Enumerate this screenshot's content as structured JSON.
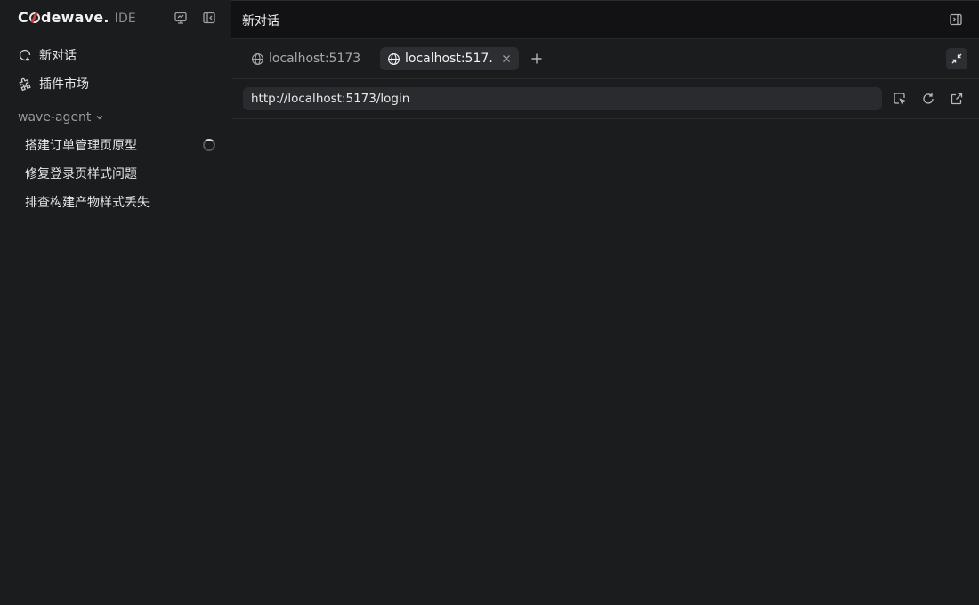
{
  "brand": {
    "first_letter": "C",
    "rest": "dewave",
    "dot": ".",
    "suffix": "IDE"
  },
  "sidebar": {
    "nav": [
      {
        "label": "新对话",
        "icon": "new-chat-icon"
      },
      {
        "label": "插件市场",
        "icon": "puzzle-icon"
      }
    ],
    "group": {
      "label": "wave-agent",
      "icon": "chevron-down-icon"
    },
    "sessions": [
      {
        "label": "搭建订单管理页原型",
        "loading": true
      },
      {
        "label": "修复登录页样式问题",
        "loading": false
      },
      {
        "label": "排查构建产物样式丢失",
        "loading": false
      }
    ],
    "header_icons": [
      "monitor-icon",
      "collapse-sidebar-icon"
    ]
  },
  "main": {
    "title": "新对话",
    "tabs": [
      {
        "label": "localhost:5173",
        "active": false
      },
      {
        "label": "localhost:517…",
        "active": true
      }
    ],
    "address": {
      "value": "http://localhost:5173/login"
    },
    "address_icons": [
      "select-element-icon",
      "reload-icon",
      "open-external-icon"
    ]
  }
}
